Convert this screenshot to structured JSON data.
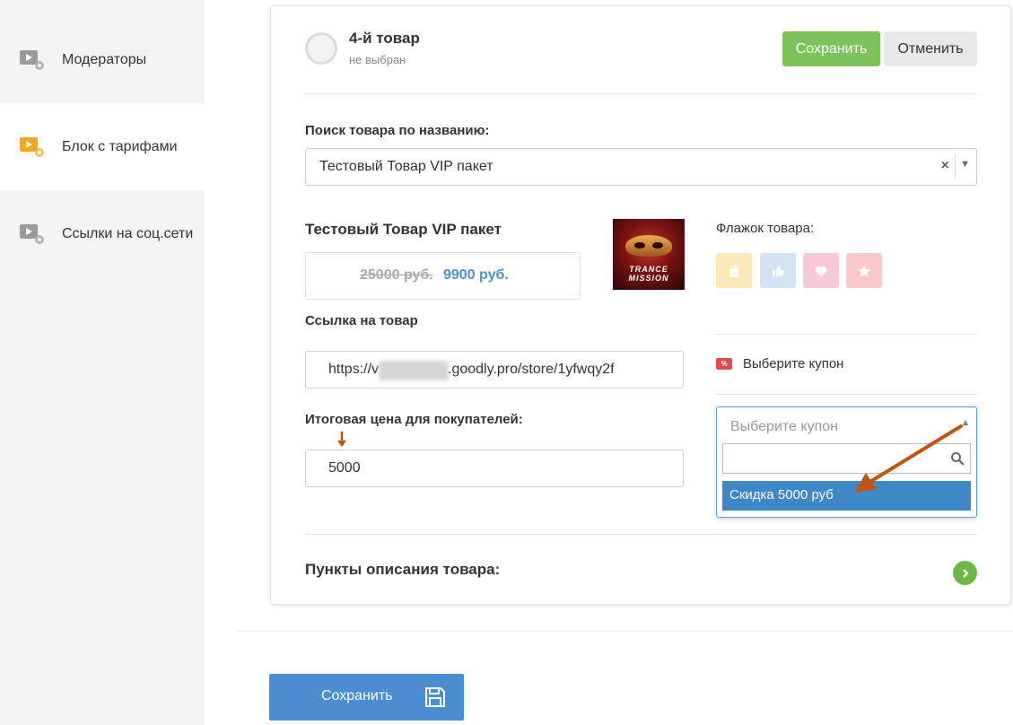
{
  "sidebar": {
    "items": [
      {
        "label": "Модераторы",
        "active": false
      },
      {
        "label": "Блок с тарифами",
        "active": true
      },
      {
        "label": "Ссылки на соц.сети",
        "active": false
      }
    ]
  },
  "card": {
    "title": "4-й товар",
    "subtitle": "не выбран",
    "save_label": "Сохранить",
    "cancel_label": "Отменить",
    "search_label": "Поиск товара по названию:",
    "search_value": "Тестовый Товар VIP пакет",
    "clear_symbol": "×",
    "product_name": "Тестовый Товар VIP пакет",
    "price_old": "25000 руб.",
    "price_new": "9900 руб.",
    "thumb_text": "TRANCE MISSION",
    "flag_label": "Флажок товара:",
    "flags": [
      {
        "name": "bag",
        "color": "#fde8b8"
      },
      {
        "name": "thumbs-up",
        "color": "#d3e3f5"
      },
      {
        "name": "heart",
        "color": "#f9c8da"
      },
      {
        "name": "star",
        "color": "#fbc9c9"
      }
    ],
    "link_label": "Ссылка на товар",
    "link_prefix": "https://v",
    "link_suffix": ".goodly.pro/store/1yfwqy2f",
    "coupon_icon_text": "%",
    "coupon_label": "Выберите купон",
    "total_label": "Итоговая цена для покупателей:",
    "total_value": "5000",
    "coupon_dropdown": {
      "placeholder": "Выберите купон",
      "search_value": "",
      "options": [
        "Скидка 5000 руб"
      ]
    },
    "description_label": "Пункты описания товара:"
  },
  "footer": {
    "save_label": "Сохранить"
  },
  "colors": {
    "accent_green": "#7dc35b",
    "accent_blue": "#4a8ed1",
    "annotation_arrow": "#c0560d"
  }
}
